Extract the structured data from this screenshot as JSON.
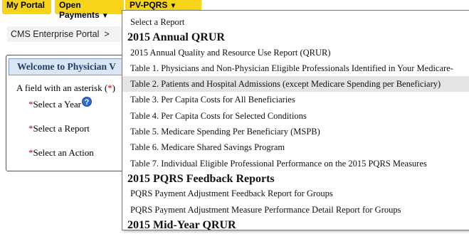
{
  "nav": {
    "my_portal": "My Portal",
    "open_payments": "Open Payments",
    "pv_pqrs": "PV-PQRS",
    "arrow": "▼",
    "tab_color": "#f7d417"
  },
  "breadcrumb": {
    "text": "CMS Enterprise Portal",
    "separator": ">"
  },
  "panel": {
    "title": "Welcome to Physician V",
    "required_note_pre": "A field with an asterisk (",
    "required_note_star": "*",
    "required_note_post": ")",
    "asterisk": "*",
    "select_year": "Select a Year",
    "select_report": "Select a Report",
    "select_action": "Select an Action",
    "help_icon": "?"
  },
  "dropdown": {
    "placeholder": "Select a Report",
    "groups": [
      {
        "label": "2015 Annual QRUR",
        "options": [
          "2015 Annual Quality and Resource Use Report (QRUR)",
          "Table 1. Physicians and Non-Physician Eligible Professionals Identified in Your Medicare-",
          "Table 2. Patients and Hospital Admissions (except Medicare Spending per Beneficiary)",
          "Table 3. Per Capita Costs for All Beneficiaries",
          "Table 4. Per Capita Costs for Selected Conditions",
          "Table 5. Medicare Spending Per Beneficiary (MSPB)",
          "Table 6. Medicare Shared Savings Program",
          "Table 7. Individual Eligible Professional Performance on the 2015 PQRS Measures"
        ]
      },
      {
        "label": "2015 PQRS Feedback Reports",
        "options": [
          "PQRS Payment Adjustment Feedback Report for Groups",
          "PQRS Payment Adjustment Measure Performance Detail Report for Groups"
        ]
      },
      {
        "label": "2015 Mid-Year QRUR",
        "options": []
      }
    ],
    "highlighted_option": "Table 2. Patients and Hospital Admissions (except Medicare Spending per Beneficiary)"
  }
}
